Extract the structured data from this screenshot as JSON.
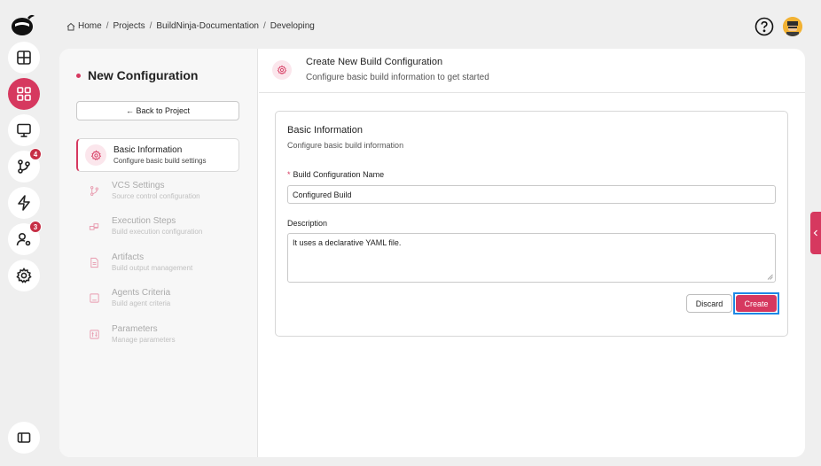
{
  "breadcrumb": {
    "items": [
      "Home",
      "Projects",
      "BuildNinja-Documentation",
      "Developing"
    ],
    "separator": "/"
  },
  "rail": {
    "badges": {
      "vcs": "4",
      "users": "3"
    }
  },
  "sidebar": {
    "title": "New Configuration",
    "back_label": "← Back to Project",
    "steps": [
      {
        "label": "Basic Information",
        "sub": "Configure basic build settings"
      },
      {
        "label": "VCS Settings",
        "sub": "Source control configuration"
      },
      {
        "label": "Execution Steps",
        "sub": "Build execution configuration"
      },
      {
        "label": "Artifacts",
        "sub": "Build output management"
      },
      {
        "label": "Agents Criteria",
        "sub": "Build agent criteria"
      },
      {
        "label": "Parameters",
        "sub": "Manage parameters"
      }
    ]
  },
  "header": {
    "title": "Create New Build Configuration",
    "subtitle": "Configure basic build information to get started"
  },
  "form": {
    "title": "Basic Information",
    "subtitle": "Configure basic build information",
    "name_label": "Build Configuration Name",
    "name_required": "*",
    "name_value": "Configured Build",
    "desc_label": "Description",
    "desc_value": "It uses a declarative YAML file.",
    "discard_label": "Discard",
    "create_label": "Create"
  },
  "colors": {
    "accent": "#d6385f",
    "focus_ring": "#1e88e5",
    "background": "#efefef"
  }
}
